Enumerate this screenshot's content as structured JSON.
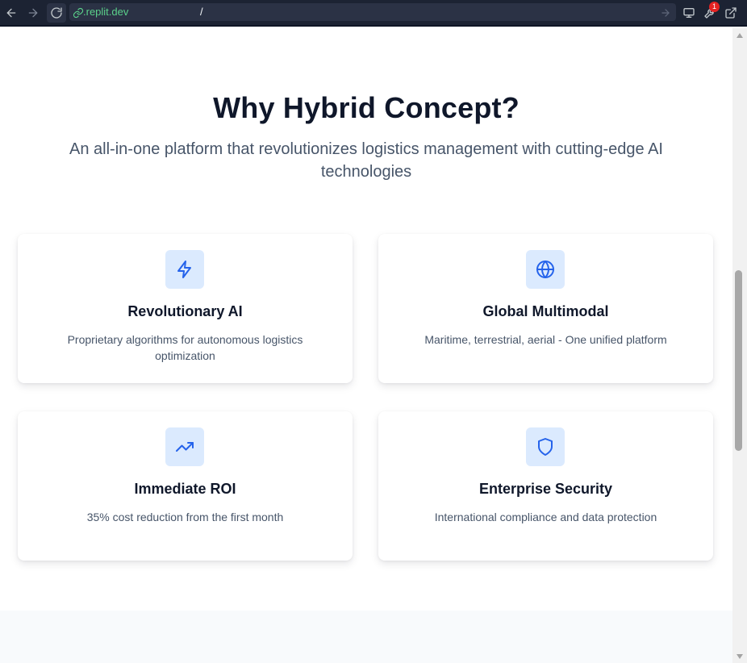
{
  "browser": {
    "url_host": ".replit.dev",
    "url_path": "/",
    "notification_count": "1"
  },
  "section": {
    "heading": "Why Hybrid Concept?",
    "subtitle": "An all-in-one platform that revolutionizes logistics management with cutting-edge AI technologies"
  },
  "features": [
    {
      "icon": "lightning-icon",
      "title": "Revolutionary AI",
      "description": "Proprietary algorithms for autonomous logistics optimization"
    },
    {
      "icon": "globe-icon",
      "title": "Global Multimodal",
      "description": "Maritime, terrestrial, aerial - One unified platform"
    },
    {
      "icon": "trending-up-icon",
      "title": "Immediate ROI",
      "description": "35% cost reduction from the first month"
    },
    {
      "icon": "shield-icon",
      "title": "Enterprise Security",
      "description": "International compliance and data protection"
    }
  ],
  "colors": {
    "accent": "#2563eb",
    "icon_bg": "#dbeafe",
    "heading": "#0f172a",
    "body_text": "#475569",
    "toolbar_bg": "#1c2333",
    "url_green": "#5bd18b"
  }
}
